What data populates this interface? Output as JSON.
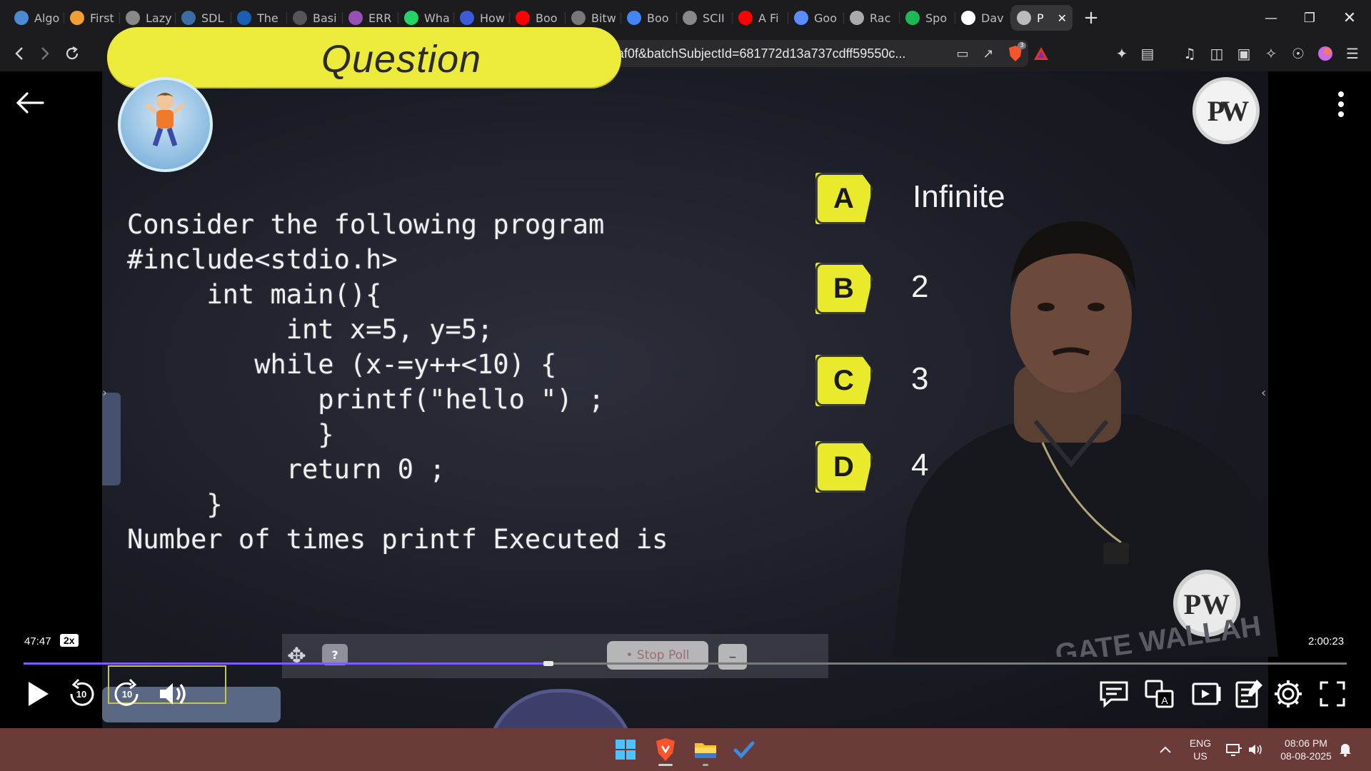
{
  "browser": {
    "tabs": [
      {
        "label": "Algo",
        "favicon": "globe-icon",
        "color": "#4b8bd6"
      },
      {
        "label": "First",
        "favicon": "bolt-icon",
        "color": "#f0a030"
      },
      {
        "label": "Lazy",
        "favicon": "globe-icon",
        "color": "#888"
      },
      {
        "label": "SDL",
        "favicon": "book-icon",
        "color": "#3a6ea5"
      },
      {
        "label": "The",
        "favicon": "w3-icon",
        "color": "#1a5fb4"
      },
      {
        "label": "Basi",
        "favicon": "page-icon",
        "color": "#555"
      },
      {
        "label": "ERR",
        "favicon": "tree-icon",
        "color": "#9a4fb5"
      },
      {
        "label": "Wha",
        "favicon": "whatsapp-icon",
        "color": "#25d366"
      },
      {
        "label": "How",
        "favicon": "bookmark-icon",
        "color": "#3b5bdb"
      },
      {
        "label": "Boo",
        "favicon": "youtube-icon",
        "color": "#ff0000"
      },
      {
        "label": "Bitw",
        "favicon": "code-icon",
        "color": "#777"
      },
      {
        "label": "Boo",
        "favicon": "google-icon",
        "color": "#4285f4"
      },
      {
        "label": "SCII",
        "favicon": "globe-icon",
        "color": "#888"
      },
      {
        "label": "A Fi",
        "favicon": "youtube-icon",
        "color": "#ff0000"
      },
      {
        "label": "Goo",
        "favicon": "gemini-icon",
        "color": "#5a8cff"
      },
      {
        "label": "Rac",
        "favicon": "openai-icon",
        "color": "#aaa"
      },
      {
        "label": "Spo",
        "favicon": "spotify-icon",
        "color": "#1db954"
      },
      {
        "label": "Dav",
        "favicon": "wikipedia-icon",
        "color": "#fff"
      },
      {
        "label": "P",
        "favicon": "speaker-icon",
        "color": "#bbb",
        "active": true
      }
    ],
    "url": "https://www.pw.live/watch/?batchSlug=6816e8e4df816c6bffffaf0f&batchSubjectId=681772d13a737cdff59550c...",
    "brave_badge": "3"
  },
  "lecture": {
    "banner_title": "Question",
    "code_lines": [
      "Consider the following program",
      "#include<stdio.h>",
      "     int main(){",
      "          int x=5, y=5;",
      "        while (x-=y++<10) {",
      "            printf(\"hello \") ;",
      "            }",
      "          return 0 ;",
      "     }",
      "Number of times printf Executed is"
    ],
    "options": [
      {
        "letter": "A",
        "text": "Infinite"
      },
      {
        "letter": "B",
        "text": "2"
      },
      {
        "letter": "C",
        "text": "3"
      },
      {
        "letter": "D",
        "text": "4"
      }
    ],
    "logo_text": "PW",
    "shirt_text": "GATE WALLAH",
    "accent_yellow": "#ecea3a"
  },
  "poll": {
    "help_label": "?",
    "stop_label": "• Stop Poll",
    "minimize_label": "–"
  },
  "player": {
    "current_time": "47:47",
    "speed": "2x",
    "duration": "2:00:23",
    "progress_fraction": 0.3968,
    "progress_color": "#7c5cff",
    "skip_back_label": "10",
    "skip_forward_label": "10"
  },
  "taskbar": {
    "lang_line1": "ENG",
    "lang_line2": "US",
    "time": "08:06 PM",
    "date": "08-08-2025"
  }
}
